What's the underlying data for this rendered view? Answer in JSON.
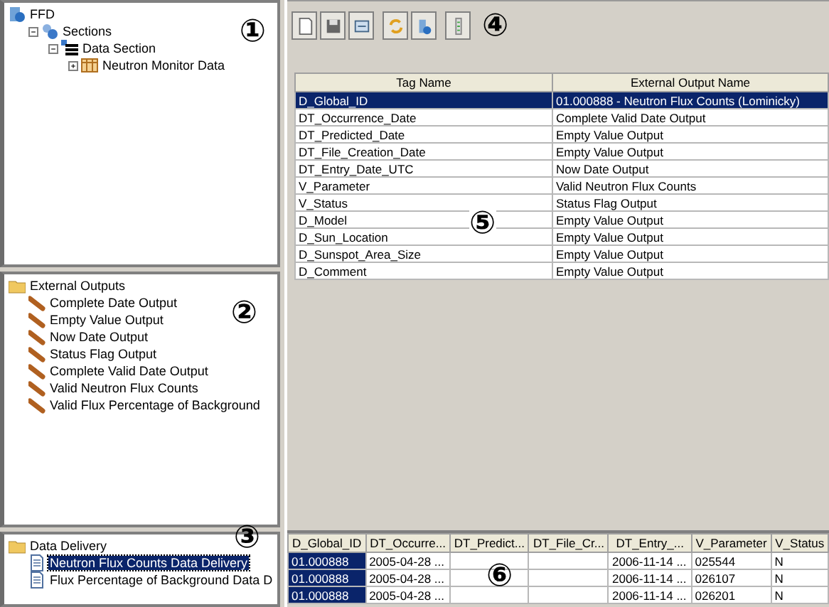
{
  "panes": [
    {
      "callout": "①",
      "tree": [
        {
          "label": "FFD",
          "kind": "app",
          "children": [
            {
              "label": "Sections",
              "kind": "sections",
              "expanded": true,
              "children": [
                {
                  "label": "Data Section",
                  "kind": "section",
                  "expanded": true,
                  "children": [
                    {
                      "label": "Neutron Monitor Data",
                      "kind": "table",
                      "expanded": false
                    }
                  ]
                }
              ]
            }
          ]
        }
      ]
    },
    {
      "callout": "②",
      "tree": [
        {
          "label": "External Outputs",
          "kind": "folder",
          "children": [
            {
              "label": "Complete Date Output",
              "kind": "output"
            },
            {
              "label": "Empty Value Output",
              "kind": "output"
            },
            {
              "label": "Now Date Output",
              "kind": "output"
            },
            {
              "label": "Status Flag Output",
              "kind": "output"
            },
            {
              "label": "Complete Valid Date Output",
              "kind": "output"
            },
            {
              "label": "Valid Neutron Flux Counts",
              "kind": "output"
            },
            {
              "label": "Valid Flux Percentage of Background",
              "kind": "output"
            }
          ]
        }
      ]
    },
    {
      "callout": "③",
      "tree": [
        {
          "label": "Data Delivery",
          "kind": "folder",
          "children": [
            {
              "label": "Neutron Flux Counts Data Delivery",
              "kind": "document",
              "selected": true
            },
            {
              "label": "Flux Percentage of Background Data D",
              "kind": "document",
              "selected": false
            }
          ]
        }
      ]
    }
  ],
  "toolbar": {
    "callout": "④"
  },
  "mapping_table": {
    "callout": "⑤",
    "columns": [
      "Tag Name",
      "External Output Name"
    ],
    "rows": [
      {
        "cells": [
          "D_Global_ID",
          "01.000888 - Neutron Flux Counts (Lominicky)"
        ],
        "selected": true
      },
      {
        "cells": [
          "DT_Occurrence_Date",
          "Complete Valid Date Output"
        ],
        "selected": false
      },
      {
        "cells": [
          "DT_Predicted_Date",
          "Empty Value Output"
        ],
        "selected": false
      },
      {
        "cells": [
          "DT_File_Creation_Date",
          "Empty Value Output"
        ],
        "selected": false
      },
      {
        "cells": [
          "DT_Entry_Date_UTC",
          "Now Date Output"
        ],
        "selected": false
      },
      {
        "cells": [
          "V_Parameter",
          "Valid Neutron Flux Counts"
        ],
        "selected": false
      },
      {
        "cells": [
          "V_Status",
          "Status Flag Output"
        ],
        "selected": false
      },
      {
        "cells": [
          "D_Model",
          "Empty Value Output"
        ],
        "selected": false
      },
      {
        "cells": [
          "D_Sun_Location",
          "Empty Value Output"
        ],
        "selected": false
      },
      {
        "cells": [
          "D_Sunspot_Area_Size",
          "Empty Value Output"
        ],
        "selected": false
      },
      {
        "cells": [
          "D_Comment",
          "Empty Value Output"
        ],
        "selected": false
      }
    ]
  },
  "data_table": {
    "callout": "⑥",
    "columns": [
      {
        "label": "D_Global_ID",
        "selected": true
      },
      {
        "label": "DT_Occurre...",
        "selected": false
      },
      {
        "label": "DT_Predict...",
        "selected": false
      },
      {
        "label": "DT_File_Cr...",
        "selected": false
      },
      {
        "label": "DT_Entry_...",
        "selected": false
      },
      {
        "label": "V_Parameter",
        "selected": false
      },
      {
        "label": "V_Status",
        "selected": false
      }
    ],
    "rows": [
      [
        "01.000888",
        "2005-04-28 ...",
        "",
        "",
        "2006-11-14 ...",
        "025544",
        "N"
      ],
      [
        "01.000888",
        "2005-04-28 ...",
        "",
        "",
        "2006-11-14 ...",
        "026107",
        "N"
      ],
      [
        "01.000888",
        "2005-04-28 ...",
        "",
        "",
        "2006-11-14 ...",
        "026201",
        "N"
      ]
    ]
  }
}
